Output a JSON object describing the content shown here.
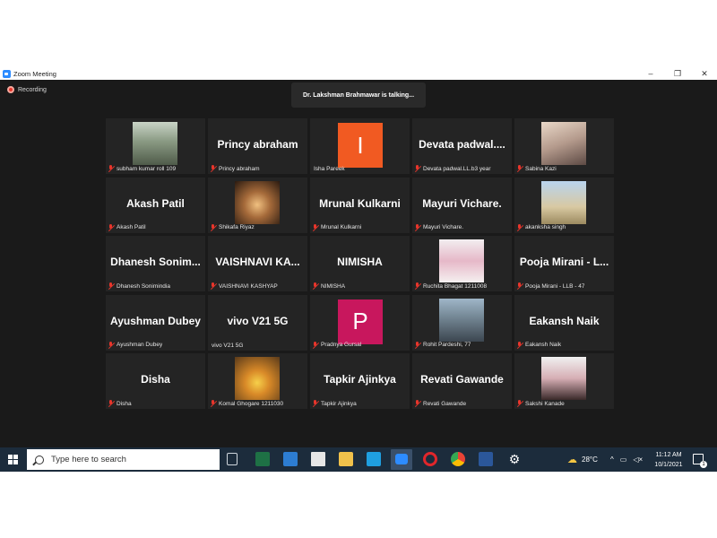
{
  "window": {
    "title": "Zoom Meeting",
    "minimize": "–",
    "restore": "❐",
    "close": "✕"
  },
  "meeting": {
    "recording_label": "Recording",
    "talking_banner": "Dr. Lakshman Brahmawar is talking..."
  },
  "participants": [
    {
      "display": "",
      "label": "subham kumar roll 109",
      "muted": true,
      "kind": "photo"
    },
    {
      "display": "Princy abraham",
      "label": "Princy abraham",
      "muted": true,
      "kind": "name"
    },
    {
      "display": "I",
      "label": "Isha Pareek",
      "muted": false,
      "kind": "avatar",
      "color": "#f15a22"
    },
    {
      "display": "Devata padwal....",
      "label": "Devata padwal.LL.b3 year",
      "muted": true,
      "kind": "name"
    },
    {
      "display": "",
      "label": "Sabina Kazi",
      "muted": true,
      "kind": "photo"
    },
    {
      "display": "Akash Patil",
      "label": "Akash Patil",
      "muted": true,
      "kind": "name"
    },
    {
      "display": "",
      "label": "Shikafa Riyaz",
      "muted": true,
      "kind": "photo"
    },
    {
      "display": "Mrunal Kulkarni",
      "label": "Mrunal Kulkarni",
      "muted": true,
      "kind": "name"
    },
    {
      "display": "Mayuri Vichare.",
      "label": "Mayuri Vichare.",
      "muted": true,
      "kind": "name"
    },
    {
      "display": "",
      "label": "akanksha singh",
      "muted": true,
      "kind": "photo"
    },
    {
      "display": "Dhanesh Sonim...",
      "label": "Dhanesh Sonimindia",
      "muted": true,
      "kind": "name"
    },
    {
      "display": "VAISHNAVI KA...",
      "label": "VAISHNAVI KASHYAP",
      "muted": true,
      "kind": "name"
    },
    {
      "display": "NIMISHA",
      "label": "NIMISHA",
      "muted": true,
      "kind": "name"
    },
    {
      "display": "",
      "label": "Ruchita Bhagat 1211008",
      "muted": true,
      "kind": "photo"
    },
    {
      "display": "Pooja Mirani - L...",
      "label": "Pooja Mirani - LLB - 47",
      "muted": true,
      "kind": "name"
    },
    {
      "display": "Ayushman Dubey",
      "label": "Ayushman Dubey",
      "muted": true,
      "kind": "name"
    },
    {
      "display": "vivo V21 5G",
      "label": "vivo V21 5G",
      "muted": false,
      "kind": "name"
    },
    {
      "display": "P",
      "label": "Pradnya Gursal",
      "muted": true,
      "kind": "avatar",
      "color": "#c8175d"
    },
    {
      "display": "",
      "label": "Rohit Pardeshi, 77",
      "muted": true,
      "kind": "photo"
    },
    {
      "display": "Eakansh Naik",
      "label": "Eakansh Naik",
      "muted": true,
      "kind": "name"
    },
    {
      "display": "Disha",
      "label": "Disha",
      "muted": true,
      "kind": "name"
    },
    {
      "display": "",
      "label": "Komal Ghogare 1211030",
      "muted": true,
      "kind": "photo"
    },
    {
      "display": "Tapkir Ajinkya",
      "label": "Tapkir Ajinkya",
      "muted": true,
      "kind": "name"
    },
    {
      "display": "Revati Gawande",
      "label": "Revati Gawande",
      "muted": true,
      "kind": "name"
    },
    {
      "display": "",
      "label": "Sakshi Kanade",
      "muted": true,
      "kind": "photo"
    }
  ],
  "taskbar": {
    "search_placeholder": "Type here to search",
    "weather": "28°C",
    "time": "11:12 AM",
    "date": "10/1/2021",
    "notification_count": "1",
    "icons": [
      "task-view-icon",
      "excel-icon",
      "mail-icon",
      "store-icon",
      "file-explorer-icon",
      "lens-icon",
      "zoom-icon",
      "opera-icon",
      "chrome-icon",
      "word-icon",
      "settings-icon"
    ]
  },
  "colors": {
    "meeting_bg": "#1a1a1a",
    "tile_bg": "#242424",
    "muted_red": "#e8352b",
    "taskbar_bg": "#1c2c3c",
    "zoom_blue": "#2d8cff"
  }
}
